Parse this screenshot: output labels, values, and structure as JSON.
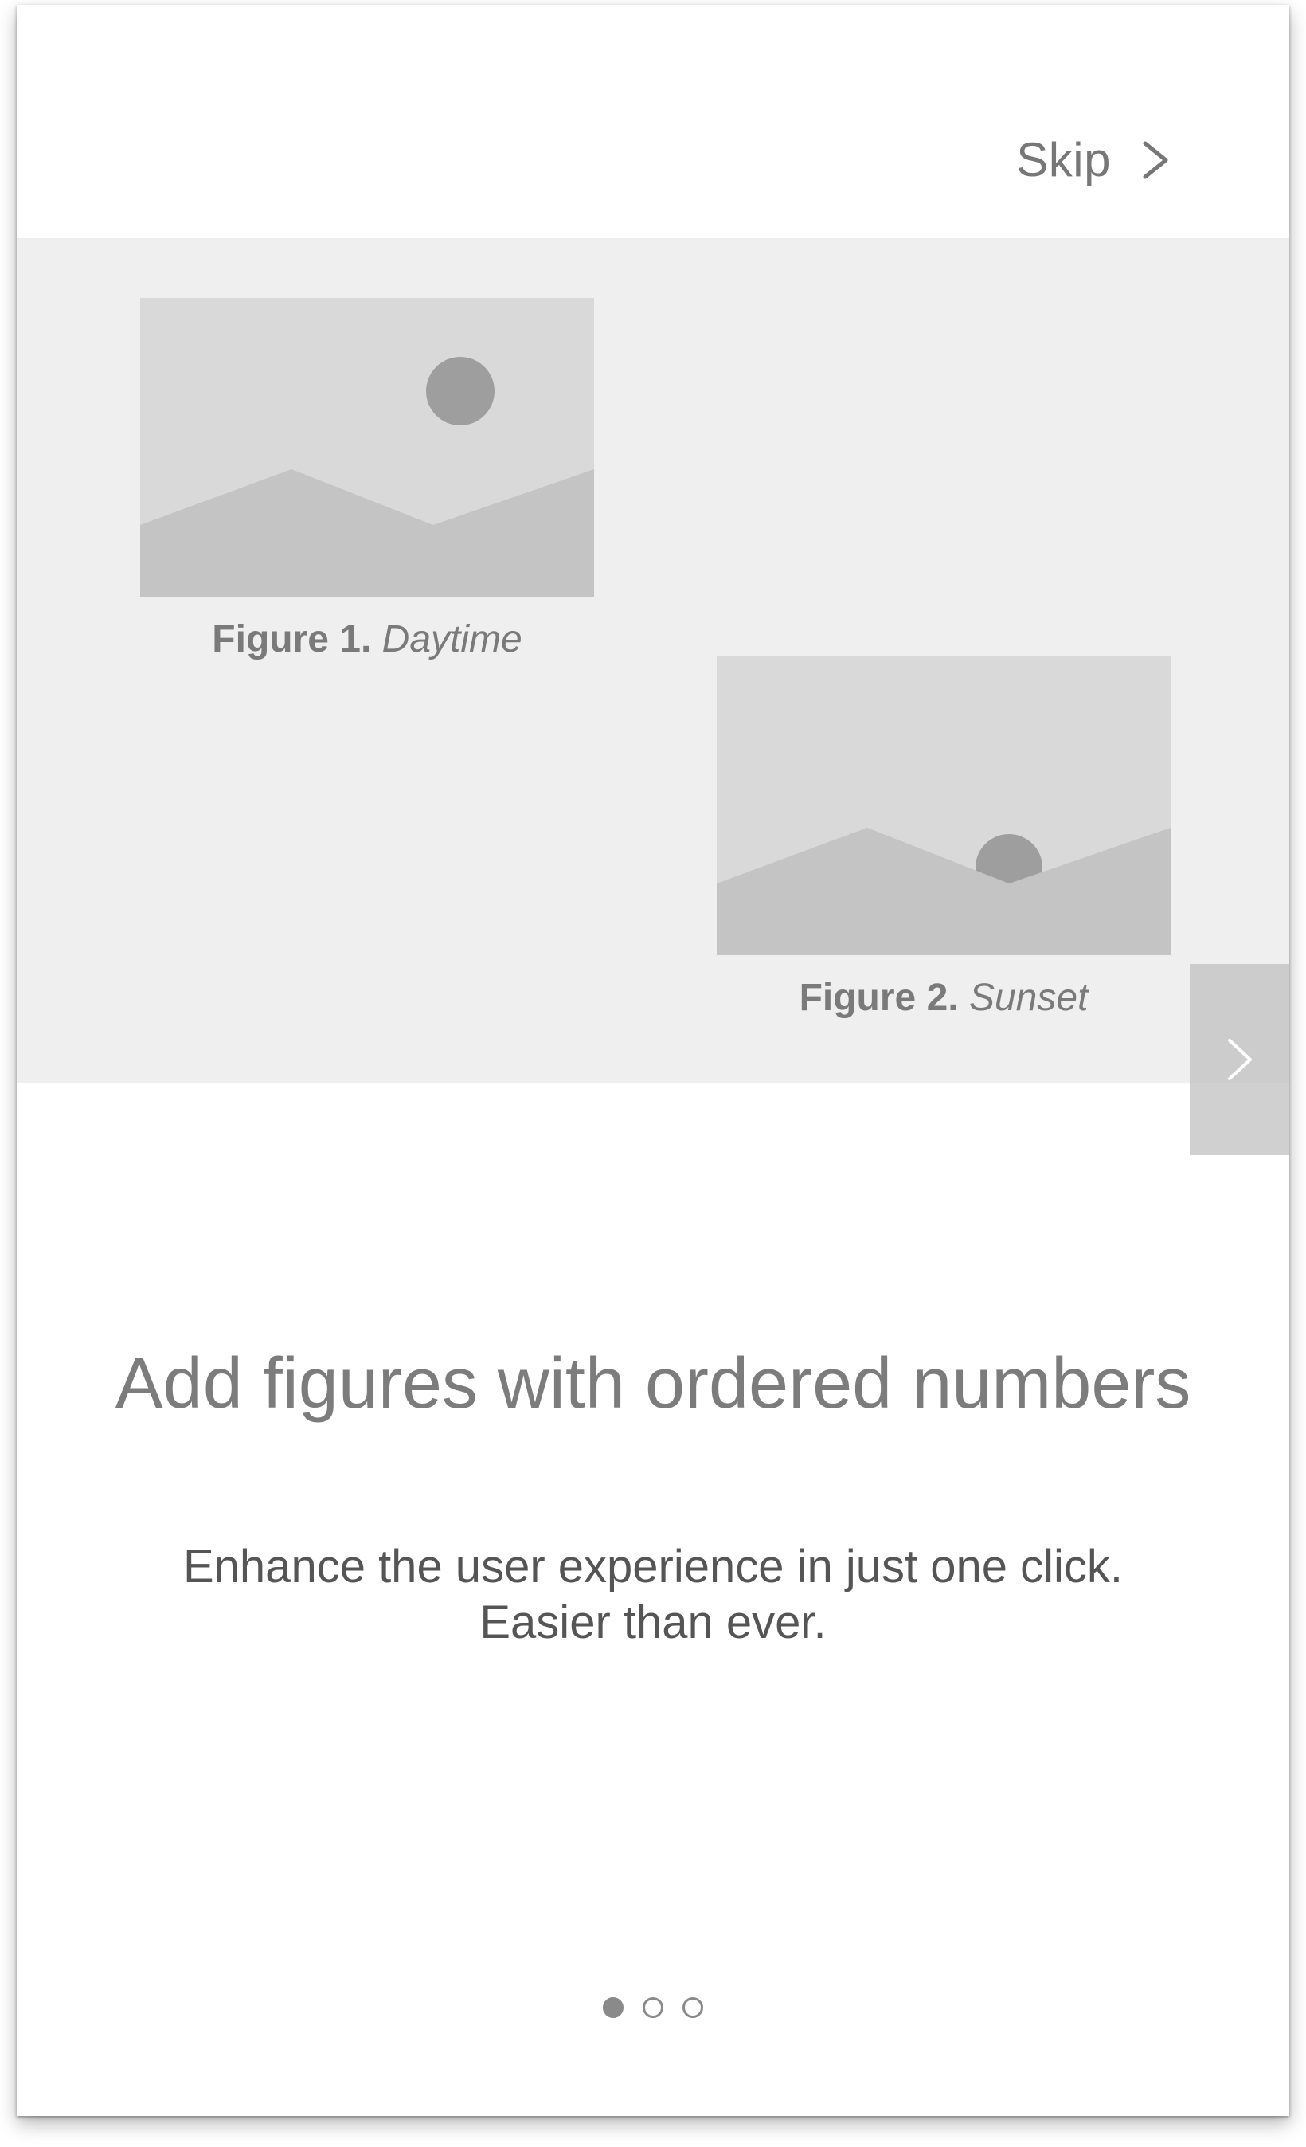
{
  "topbar": {
    "skip_label": "Skip",
    "skip_icon": "chevron-right-icon"
  },
  "figures": [
    {
      "number": "Figure 1.",
      "name": "Daytime",
      "icon": "landscape-sun-high-image"
    },
    {
      "number": "Figure 2.",
      "name": "Sunset",
      "icon": "landscape-sun-setting-image"
    }
  ],
  "pager": {
    "next_icon": "chevron-right-icon",
    "active_index": 0,
    "page_count": 3
  },
  "content": {
    "headline": "Add figures with ordered numbers",
    "subtext_line1": "Enhance the user experience in just one click.",
    "subtext_line2": "Easier than ever."
  },
  "colors": {
    "media_background": "#efefef",
    "image_placeholder": "#d9d9d9",
    "image_mountains": "#c4c4c4",
    "image_sun": "#9e9e9e"
  }
}
